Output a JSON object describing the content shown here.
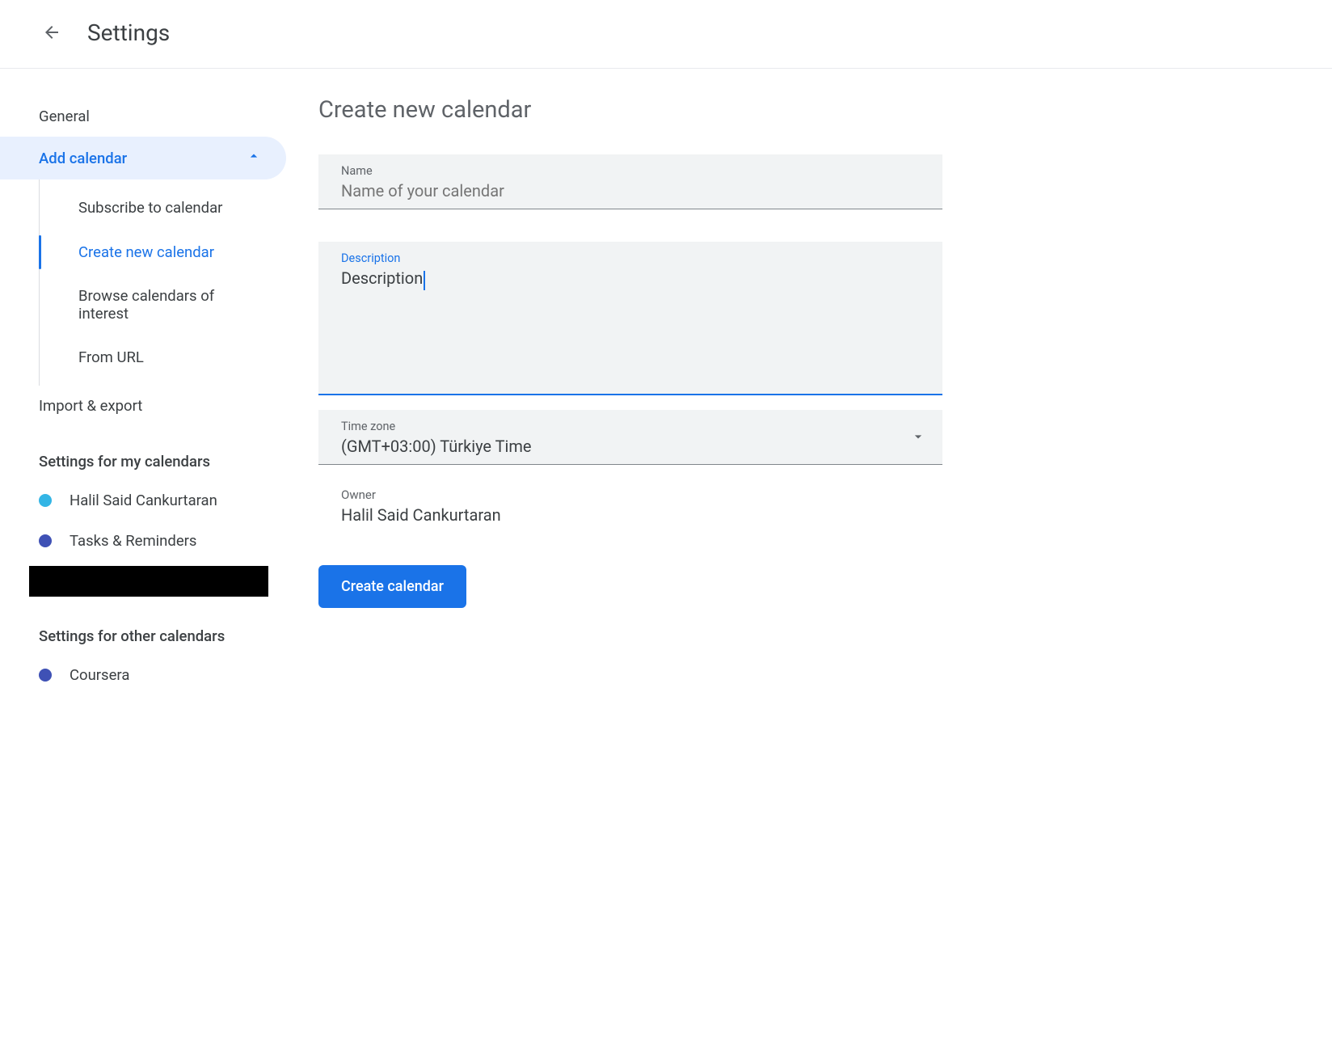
{
  "header": {
    "title": "Settings"
  },
  "sidebar": {
    "general": "General",
    "addCalendar": "Add calendar",
    "sub": {
      "subscribe": "Subscribe to calendar",
      "createNew": "Create new calendar",
      "browse": "Browse calendars of interest",
      "fromUrl": "From URL"
    },
    "importExport": "Import & export",
    "myCalsHeader": "Settings for my calendars",
    "myCals": [
      {
        "label": "Halil Said Cankurtaran",
        "color": "#33b5e5"
      },
      {
        "label": "Tasks & Reminders",
        "color": "#3f51b5"
      }
    ],
    "otherCalsHeader": "Settings for other calendars",
    "otherCals": [
      {
        "label": "Coursera",
        "color": "#3f51b5"
      }
    ]
  },
  "main": {
    "title": "Create new calendar",
    "nameLabel": "Name",
    "namePlaceholder": "Name of your calendar",
    "nameValue": "",
    "descLabel": "Description",
    "descValue": "Description",
    "tzLabel": "Time zone",
    "tzValue": "(GMT+03:00) Türkiye Time",
    "ownerLabel": "Owner",
    "ownerValue": "Halil Said Cankurtaran",
    "createBtn": "Create calendar"
  }
}
